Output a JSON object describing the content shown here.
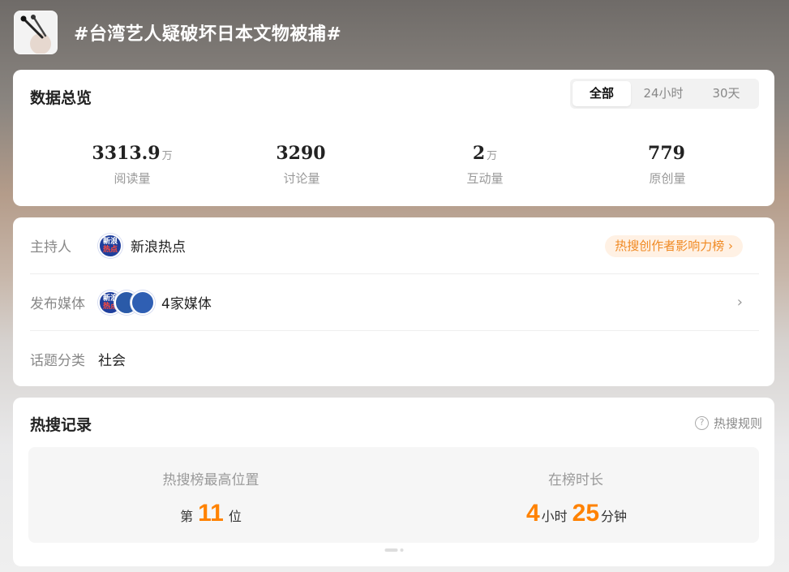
{
  "topic": {
    "title": "#台湾艺人疑破坏日本文物被捕#",
    "thumb_icon": "microphone-icon"
  },
  "overview": {
    "heading": "数据总览",
    "tabs": [
      {
        "label": "全部",
        "active": true
      },
      {
        "label": "24小时",
        "active": false
      },
      {
        "label": "30天",
        "active": false
      }
    ],
    "stats": [
      {
        "value": "3313.9",
        "unit": "万",
        "label": "阅读量"
      },
      {
        "value": "3290",
        "unit": "",
        "label": "讨论量"
      },
      {
        "value": "2",
        "unit": "万",
        "label": "互动量"
      },
      {
        "value": "779",
        "unit": "",
        "label": "原创量"
      }
    ]
  },
  "info": {
    "host": {
      "label": "主持人",
      "value": "新浪热点",
      "logo_text_1": "新浪",
      "logo_text_2": "热点"
    },
    "influence_link": "热搜创作者影响力榜 ›",
    "media": {
      "label": "发布媒体",
      "value": "4家媒体",
      "chevron": "›"
    },
    "category": {
      "label": "话题分类",
      "value": "社会"
    }
  },
  "record": {
    "heading": "热搜记录",
    "rule_link": "热搜规则",
    "highest": {
      "title": "热搜榜最高位置",
      "prefix": "第",
      "number": "11",
      "suffix": "位"
    },
    "duration": {
      "title": "在榜时长",
      "hours": "4",
      "hours_unit": "小时",
      "minutes": "25",
      "minutes_unit": "分钟"
    }
  },
  "colors": {
    "accent": "#ff8200",
    "link": "#f08a24"
  }
}
